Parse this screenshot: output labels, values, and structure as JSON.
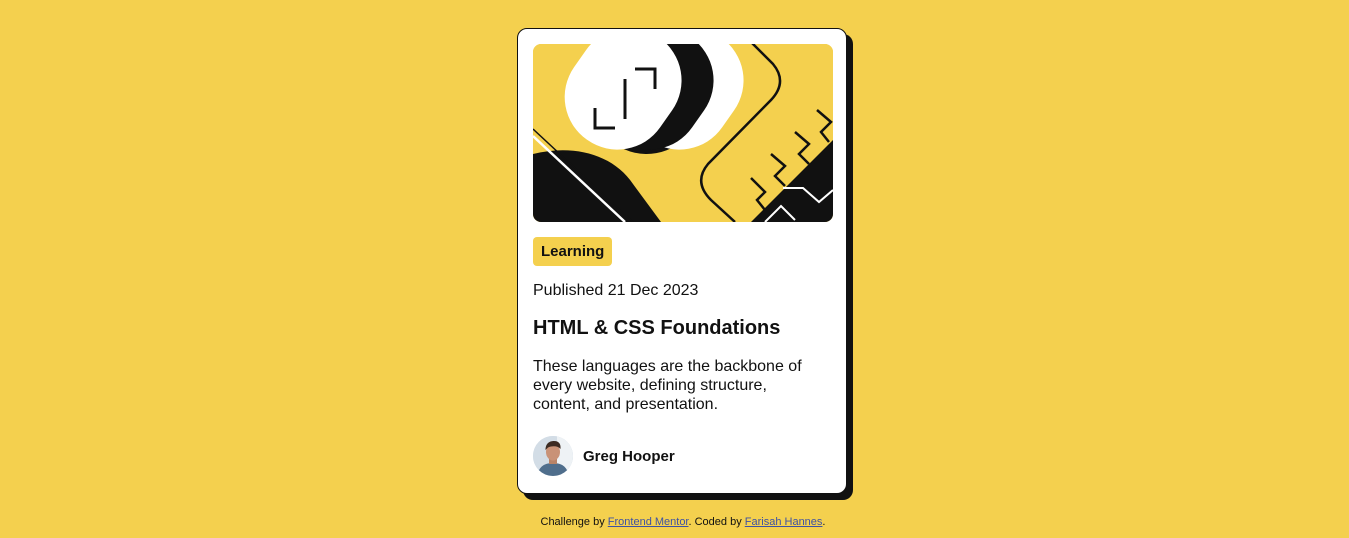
{
  "colors": {
    "background": "#f4d04e",
    "card": "#ffffff",
    "ink": "#111111",
    "link": "#3e52a3"
  },
  "card": {
    "image_icon": "abstract-illustration",
    "tag": "Learning",
    "published": "Published 21 Dec 2023",
    "title": "HTML & CSS Foundations",
    "description": "These languages are the backbone of every website, defining structure, content, and presentation.",
    "author": {
      "avatar_icon": "avatar-photo",
      "name": "Greg Hooper"
    }
  },
  "attribution": {
    "prefix": "Challenge by",
    "challenge_link": "Frontend Mentor",
    "middle": ". Coded by",
    "coder_link": "Farisah Hannes",
    "suffix": "."
  }
}
